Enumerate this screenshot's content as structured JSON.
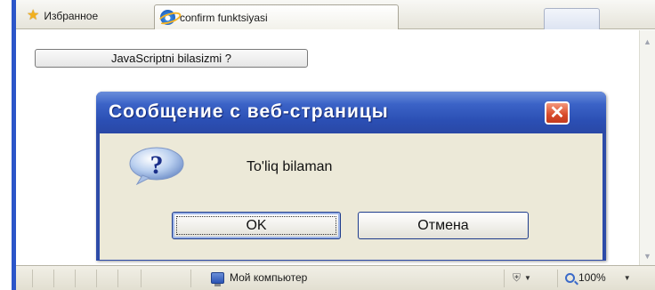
{
  "tabbar": {
    "favorites_label": "Избранное",
    "tab_title": "confirm funktsiyasi"
  },
  "page": {
    "button_label": "JavaScriptni bilasizmi ?"
  },
  "dialog": {
    "title": "Сообщение с веб-страницы",
    "close_symbol": "✕",
    "message": "To'liq bilaman",
    "ok_label": "OK",
    "cancel_label": "Отмена",
    "icon": "question-icon"
  },
  "statusbar": {
    "zone_label": "Мой компьютер",
    "zoom_label": "100%"
  },
  "colors": {
    "titlebar": "#2b4fb4",
    "dialog_client": "#ece9d8",
    "close_button": "#d84a2a"
  }
}
